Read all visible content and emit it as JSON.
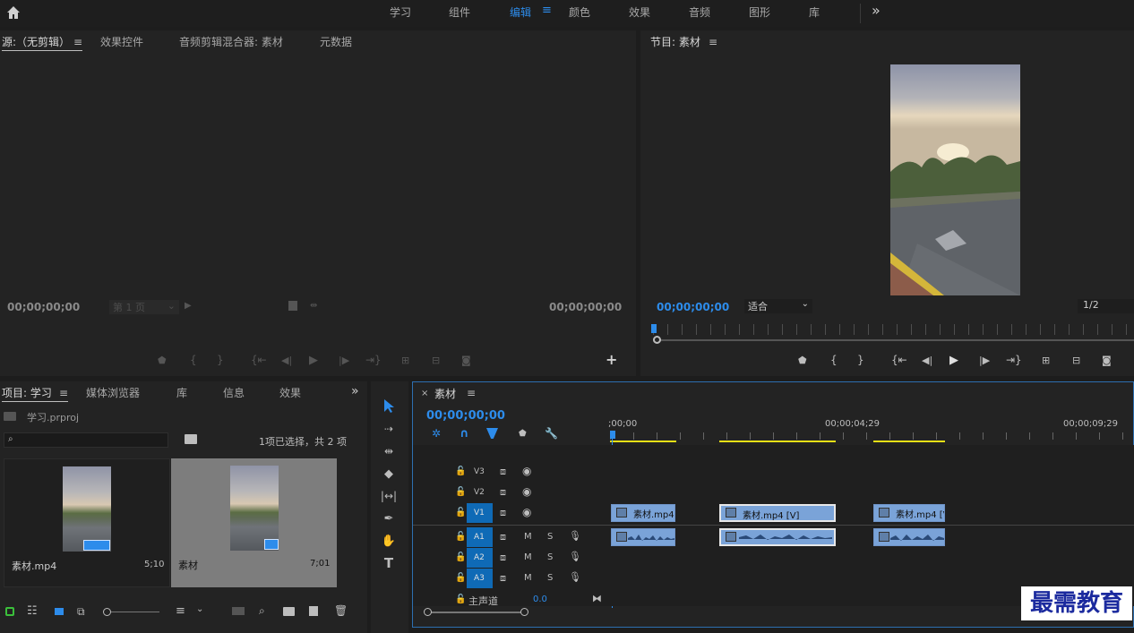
{
  "menu": {
    "items": [
      "学习",
      "组件",
      "编辑",
      "颜色",
      "效果",
      "音频",
      "图形",
      "库"
    ],
    "active_index": 2,
    "more": "»"
  },
  "source_panel": {
    "tabs": [
      "源:（无剪辑）",
      "效果控件",
      "音频剪辑混合器: 素材",
      "元数据"
    ],
    "timecode_left": "00;00;00;00",
    "page_select": "第 1 页",
    "timecode_right": "00;00;00;00"
  },
  "program_panel": {
    "title": "节目: 素材",
    "timecode": "00;00;00;00",
    "fit_label": "适合",
    "ratio_label": "1/2"
  },
  "project_panel": {
    "tabs": [
      "项目: 学习",
      "媒体浏览器",
      "库",
      "信息",
      "效果"
    ],
    "project_file": "学习.prproj",
    "selection_info": "1项已选择，共 2 项",
    "items": [
      {
        "name": "素材.mp4",
        "duration": "5;10"
      },
      {
        "name": "素材",
        "duration": "7;01"
      }
    ]
  },
  "timeline": {
    "tab_label": "素材",
    "timecode": "00;00;00;00",
    "ruler": [
      ";00;00",
      "00;00;04;29",
      "00;00;09;29"
    ],
    "tracks": {
      "video": [
        "V3",
        "V2",
        "V1"
      ],
      "audio": [
        "A1",
        "A2",
        "A3"
      ],
      "mute": "M",
      "solo": "S",
      "master_label": "主声道",
      "master_value": "0.0"
    },
    "clips": [
      "素材.mp4 [",
      "素材.mp4 [V]",
      "素材.mp4 [V"
    ]
  },
  "watermark": "最需教育",
  "colors": {
    "accent": "#2d8ceb",
    "track_selected": "#0f6ab6",
    "clip": "#7aa3d8",
    "yellow": "#e6e016"
  }
}
